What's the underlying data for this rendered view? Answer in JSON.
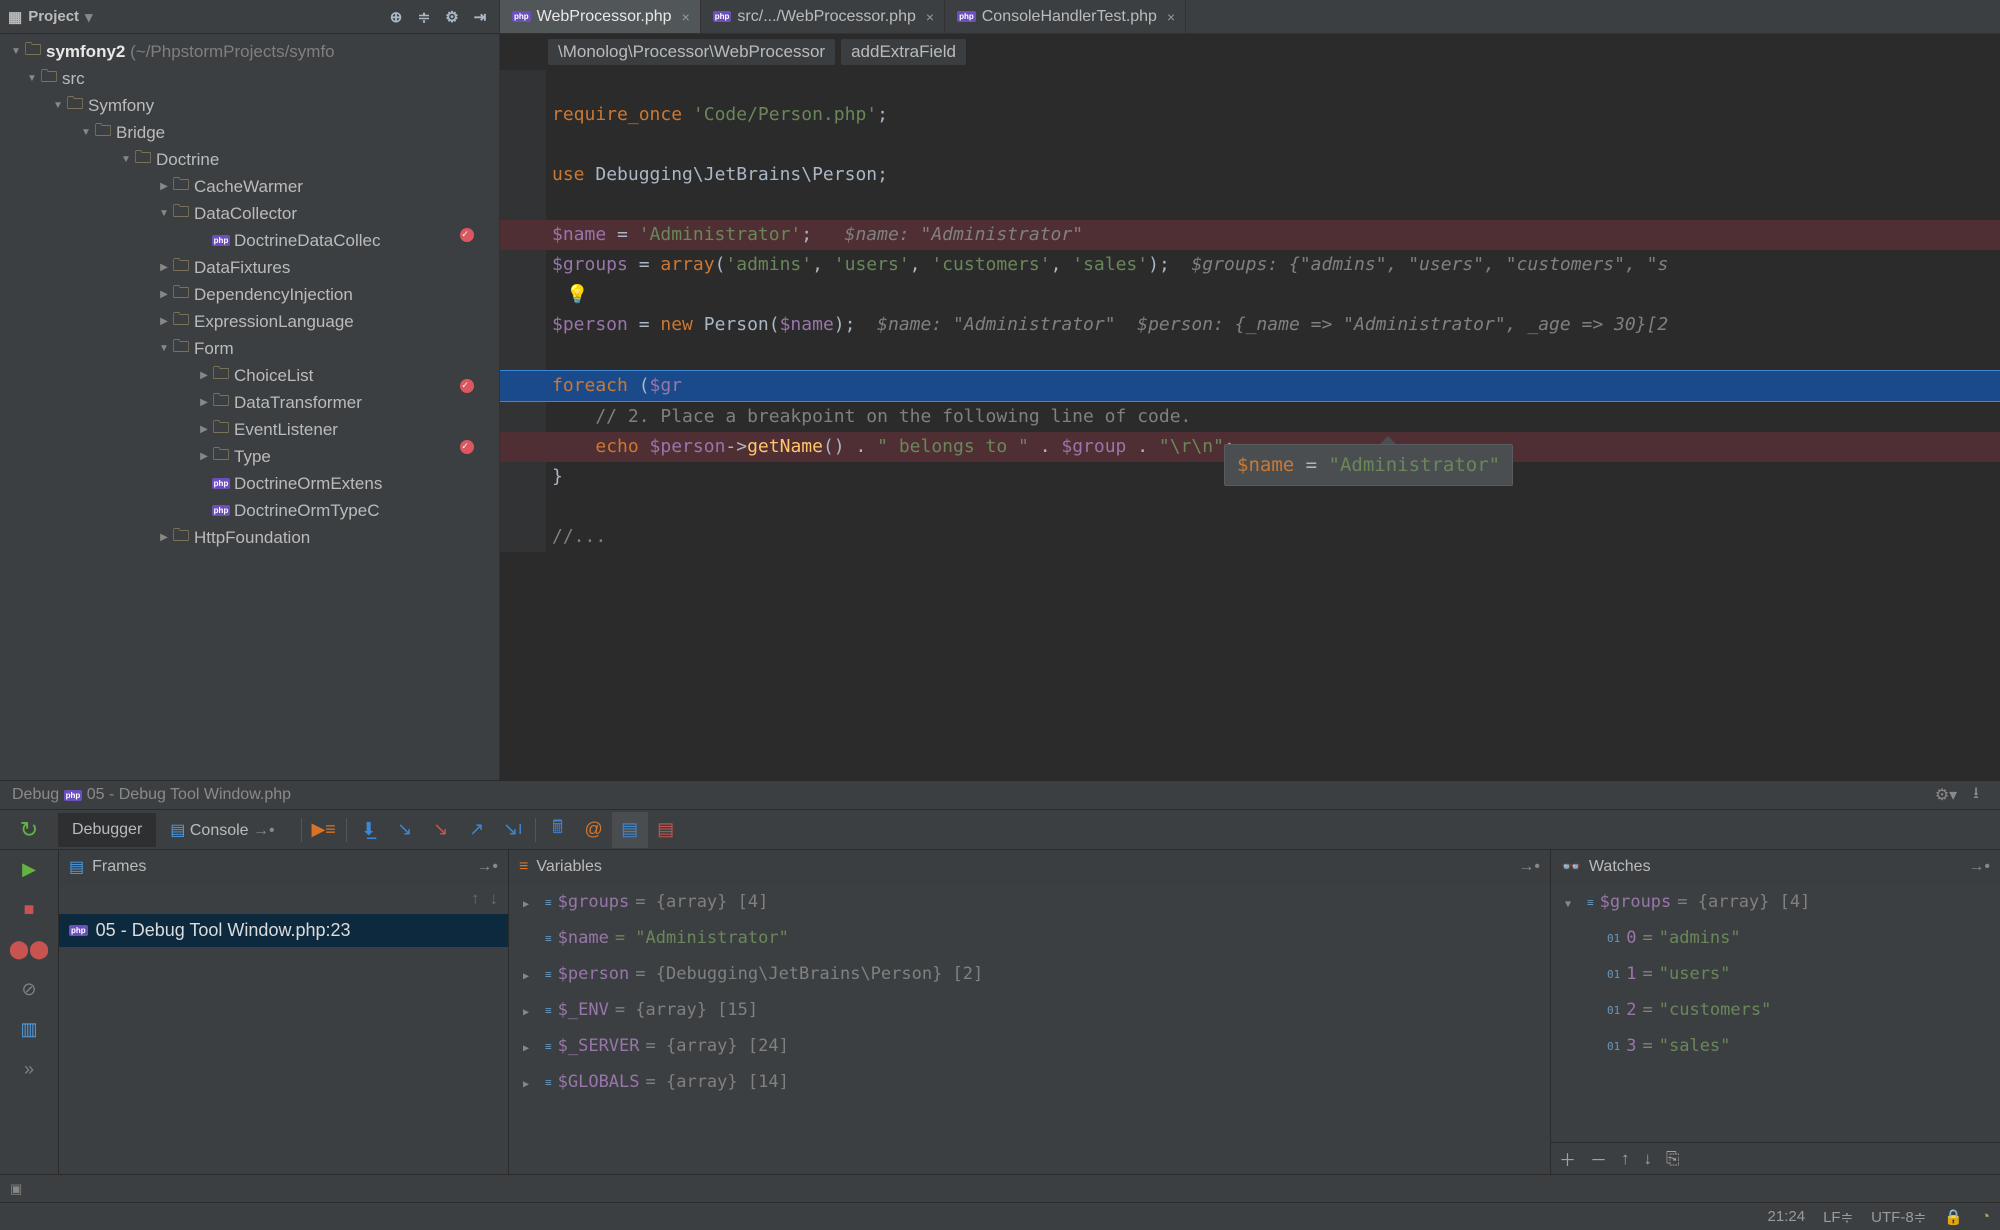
{
  "sidebar": {
    "title": "Project",
    "root_name": "symfony2",
    "root_path": "(~/PhpstormProjects/symfo",
    "tree": [
      {
        "ind": 24,
        "arrow": "open",
        "icon": "folder",
        "label": "src"
      },
      {
        "ind": 50,
        "arrow": "open",
        "icon": "folder",
        "label": "Symfony"
      },
      {
        "ind": 78,
        "arrow": "open",
        "icon": "folder",
        "label": "Bridge"
      },
      {
        "ind": 118,
        "arrow": "open",
        "icon": "folder",
        "label": "Doctrine"
      },
      {
        "ind": 156,
        "arrow": "closed",
        "icon": "folder",
        "label": "CacheWarmer"
      },
      {
        "ind": 156,
        "arrow": "open",
        "icon": "folder",
        "label": "DataCollector"
      },
      {
        "ind": 196,
        "arrow": "",
        "icon": "php",
        "label": "DoctrineDataCollec"
      },
      {
        "ind": 156,
        "arrow": "closed",
        "icon": "folder",
        "label": "DataFixtures"
      },
      {
        "ind": 156,
        "arrow": "closed",
        "icon": "folder",
        "label": "DependencyInjection"
      },
      {
        "ind": 156,
        "arrow": "closed",
        "icon": "folder",
        "label": "ExpressionLanguage"
      },
      {
        "ind": 156,
        "arrow": "open",
        "icon": "folder",
        "label": "Form"
      },
      {
        "ind": 196,
        "arrow": "closed",
        "icon": "folder",
        "label": "ChoiceList"
      },
      {
        "ind": 196,
        "arrow": "closed",
        "icon": "folder",
        "label": "DataTransformer"
      },
      {
        "ind": 196,
        "arrow": "closed",
        "icon": "folder",
        "label": "EventListener"
      },
      {
        "ind": 196,
        "arrow": "closed",
        "icon": "folder",
        "label": "Type"
      },
      {
        "ind": 196,
        "arrow": "",
        "icon": "php",
        "label": "DoctrineOrmExtens"
      },
      {
        "ind": 196,
        "arrow": "",
        "icon": "php",
        "label": "DoctrineOrmTypeC"
      },
      {
        "ind": 156,
        "arrow": "closed",
        "icon": "folder",
        "label": "HttpFoundation"
      }
    ]
  },
  "tabs": [
    {
      "label": "WebProcessor.php",
      "active": true
    },
    {
      "label": "src/.../WebProcessor.php",
      "active": false
    },
    {
      "label": "ConsoleHandlerTest.php",
      "active": false
    }
  ],
  "breadcrumb": [
    "\\Monolog\\Processor\\WebProcessor",
    "addExtraField"
  ],
  "code": {
    "l1a": "require_once ",
    "l1b": "'Code/Person.php'",
    "l1c": ";",
    "l2a": "use ",
    "l2b": "Debugging\\JetBrains\\Person;",
    "l3a": "$name",
    "l3b": " = ",
    "l3c": "'Administrator'",
    "l3d": ";   ",
    "l3h": "$name: \"Administrator\"",
    "l4a": "$groups",
    "l4b": " = ",
    "l4c": "array",
    "l4d": "(",
    "l4e": "'admins'",
    "l4f": ", ",
    "l4g": "'users'",
    "l4h": ", ",
    "l4i": "'customers'",
    "l4j": ", ",
    "l4k": "'sales'",
    "l4l": ");  ",
    "l4m": "$groups: {\"admins\", \"users\", \"customers\", \"s",
    "l5a": "$person",
    "l5b": " = ",
    "l5c": "new ",
    "l5d": "Person(",
    "l5e": "$name",
    "l5f": ");  ",
    "l5g": "$name: \"Administrator\"  $person: {_name => \"Administrator\", _age => 30}[2",
    "l6a": "foreach ",
    "l6b": "(",
    "l6c": "$gr",
    "l7a": "    // 2. Place a breakpoint on the following line of code.",
    "l8a": "    ",
    "l8b": "echo ",
    "l8c": "$person",
    "l8d": "->",
    "l8e": "getName",
    "l8f": "() . ",
    "l8g": "\" belongs to \"",
    "l8h": " . ",
    "l8i": "$group",
    "l8j": " . ",
    "l8k": "\"\\r\\n\"",
    "l8l": ";",
    "l9a": "}",
    "l10a": "//..."
  },
  "tooltip": {
    "var": "$name",
    "eq": " = ",
    "val": "\"Administrator\""
  },
  "debug": {
    "title_prefix": "Debug",
    "title": "05 - Debug Tool Window.php",
    "tabs": {
      "debugger": "Debugger",
      "console": "Console"
    },
    "frames_title": "Frames",
    "frame_row": "05 - Debug Tool Window.php:23",
    "variables_title": "Variables",
    "variables": [
      {
        "arrow": true,
        "name": "$groups",
        "rest": " = {array} [4]"
      },
      {
        "arrow": false,
        "name": "$name",
        "rest_s": " = \"Administrator\""
      },
      {
        "arrow": true,
        "name": "$person",
        "rest": " = {Debugging\\JetBrains\\Person} [2]"
      },
      {
        "arrow": true,
        "name": "$_ENV",
        "rest": " = {array} [15]"
      },
      {
        "arrow": true,
        "name": "$_SERVER",
        "rest": " = {array} [24]"
      },
      {
        "arrow": true,
        "name": "$GLOBALS",
        "rest": " = {array} [14]"
      }
    ],
    "watches_title": "Watches",
    "watches_root": {
      "name": "$groups",
      "rest": " = {array} [4]"
    },
    "watches": [
      {
        "idx": "0",
        "val": "\"admins\""
      },
      {
        "idx": "1",
        "val": "\"users\""
      },
      {
        "idx": "2",
        "val": "\"customers\""
      },
      {
        "idx": "3",
        "val": "\"sales\""
      }
    ]
  },
  "status": {
    "pos": "21:24",
    "sep": "LF≑",
    "enc": "UTF-8≑"
  }
}
